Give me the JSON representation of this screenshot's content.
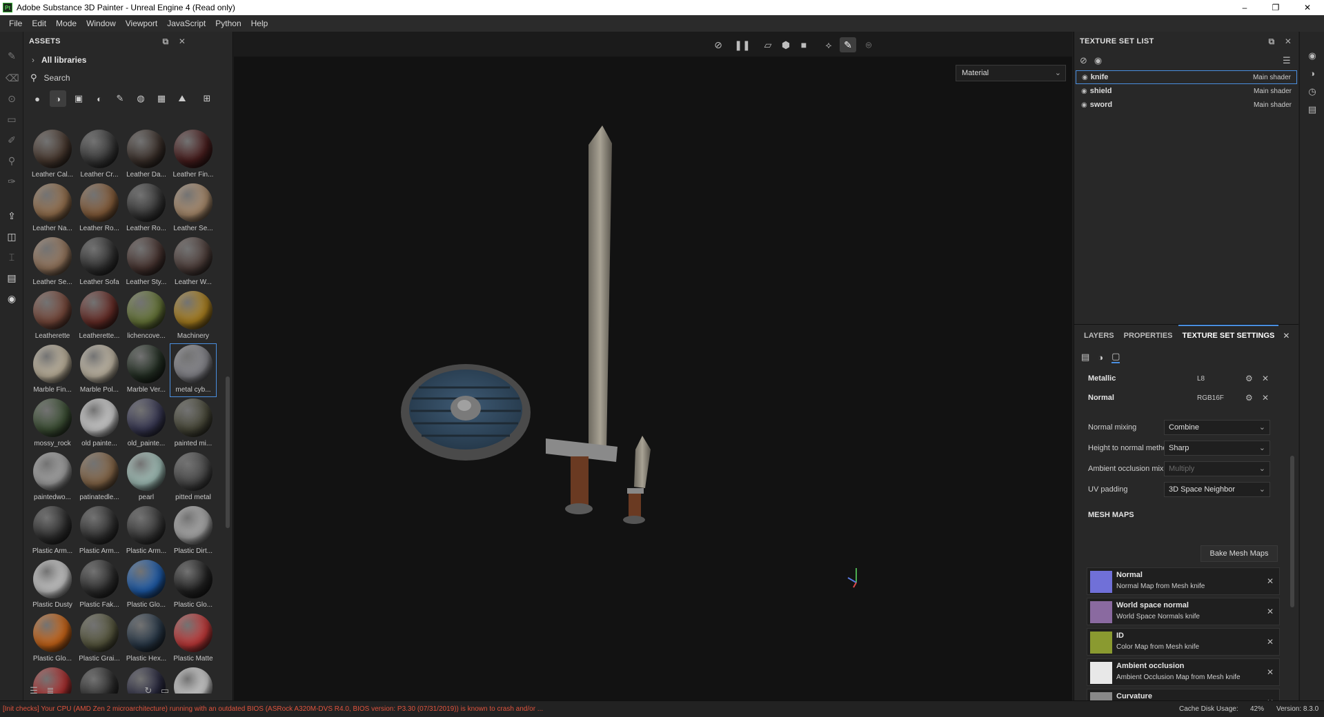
{
  "window": {
    "title": "Adobe Substance 3D Painter - Unreal Engine 4 (Read only)",
    "app_icon": "Pt",
    "controls": [
      "–",
      "❐",
      "✕"
    ]
  },
  "menu": [
    "File",
    "Edit",
    "Mode",
    "Window",
    "Viewport",
    "JavaScript",
    "Python",
    "Help"
  ],
  "assets": {
    "title": "ASSETS",
    "libraries_label": "All libraries",
    "search_label": "Search",
    "materials": [
      {
        "name": "Leather Cal...",
        "color": "#4a3a30"
      },
      {
        "name": "Leather Cr...",
        "color": "#3a3a3a"
      },
      {
        "name": "Leather Da...",
        "color": "#3d322c"
      },
      {
        "name": "Leather Fin...",
        "color": "#4a1e1e"
      },
      {
        "name": "Leather Na...",
        "color": "#9a7450"
      },
      {
        "name": "Leather Ro...",
        "color": "#8a603c"
      },
      {
        "name": "Leather Ro...",
        "color": "#383838"
      },
      {
        "name": "Leather Se...",
        "color": "#b09070"
      },
      {
        "name": "Leather Se...",
        "color": "#9a7a60"
      },
      {
        "name": "Leather Sofa",
        "color": "#333333"
      },
      {
        "name": "Leather Sty...",
        "color": "#4a3632"
      },
      {
        "name": "Leather W...",
        "color": "#50403c"
      },
      {
        "name": "Leatherette",
        "color": "#7a4a3c"
      },
      {
        "name": "Leatherette...",
        "color": "#6a2e28"
      },
      {
        "name": "lichencove...",
        "color": "#6a7a3a"
      },
      {
        "name": "Machinery",
        "color": "#b08420"
      },
      {
        "name": "Marble Fin...",
        "color": "#c8bca4"
      },
      {
        "name": "Marble Pol...",
        "color": "#cac0ac"
      },
      {
        "name": "Marble Ver...",
        "color": "#243024"
      },
      {
        "name": "metal cyb...",
        "color": "#8a8a90"
      },
      {
        "name": "mossy_rock",
        "color": "#3e5236"
      },
      {
        "name": "old painte...",
        "color": "#d8d8d8"
      },
      {
        "name": "old_painte...",
        "color": "#3a3a56"
      },
      {
        "name": "painted mi...",
        "color": "#4a4a3a"
      },
      {
        "name": "paintedwo...",
        "color": "#a8a8a8"
      },
      {
        "name": "patinatedle...",
        "color": "#8a6a4a"
      },
      {
        "name": "pearl",
        "color": "#a8c8c0"
      },
      {
        "name": "pitted metal",
        "color": "#4a4a4a"
      },
      {
        "name": "Plastic Arm...",
        "color": "#303030"
      },
      {
        "name": "Plastic Arm...",
        "color": "#333333"
      },
      {
        "name": "Plastic Arm...",
        "color": "#3a3a3a"
      },
      {
        "name": "Plastic Dirt...",
        "color": "#b0b0b0"
      },
      {
        "name": "Plastic Dusty",
        "color": "#d0d0d0"
      },
      {
        "name": "Plastic Fak...",
        "color": "#2e2e2e"
      },
      {
        "name": "Plastic Glo...",
        "color": "#1f5fb0"
      },
      {
        "name": "Plastic Glo...",
        "color": "#222222"
      },
      {
        "name": "Plastic Glo...",
        "color": "#d06818"
      },
      {
        "name": "Plastic Grai...",
        "color": "#5a5a40"
      },
      {
        "name": "Plastic Hex...",
        "color": "#2a3a4a"
      },
      {
        "name": "Plastic Matte",
        "color": "#c83a3a"
      },
      {
        "name": "",
        "color": "#b03030"
      },
      {
        "name": "",
        "color": "#2e2e2e"
      },
      {
        "name": "",
        "color": "#2a2a40"
      },
      {
        "name": "",
        "color": "#d8d8d8"
      }
    ]
  },
  "viewport": {
    "mode_select": "Material"
  },
  "texture_set_list": {
    "title": "TEXTURE SET LIST",
    "items": [
      {
        "name": "knife",
        "shader": "Main shader"
      },
      {
        "name": "shield",
        "shader": "Main shader"
      },
      {
        "name": "sword",
        "shader": "Main shader"
      }
    ]
  },
  "settings": {
    "tabs": [
      "LAYERS",
      "PROPERTIES",
      "TEXTURE SET SETTINGS"
    ],
    "channels": [
      {
        "name": "Metallic",
        "format": "L8"
      },
      {
        "name": "Normal",
        "format": "RGB16F"
      }
    ],
    "normal_mixing_label": "Normal mixing",
    "normal_mixing_value": "Combine",
    "height_method_label": "Height to normal method",
    "height_method_value": "Sharp",
    "ao_mixing_label": "Ambient occlusion mixing",
    "ao_mixing_value": "Multiply",
    "uv_padding_label": "UV padding",
    "uv_padding_value": "3D Space Neighbor",
    "mesh_maps_title": "MESH MAPS",
    "bake_button": "Bake Mesh Maps",
    "mesh_maps": [
      {
        "name": "Normal",
        "desc": "Normal Map from Mesh knife",
        "color": "#7070d8"
      },
      {
        "name": "World space normal",
        "desc": "World Space Normals knife",
        "color": "#8a6aa0"
      },
      {
        "name": "ID",
        "desc": "Color Map from Mesh knife",
        "color": "#8a9a30"
      },
      {
        "name": "Ambient occlusion",
        "desc": "Ambient Occlusion Map from Mesh knife",
        "color": "#e8e8e8"
      },
      {
        "name": "Curvature",
        "desc": "",
        "color": "#888888"
      }
    ]
  },
  "status": {
    "warning": "[Init checks] Your CPU (AMD Zen 2 microarchitecture) running with an outdated BIOS (ASRock A320M-DVS R4.0, BIOS version: P3.30 (07/31/2019)) is known to crash and/or ...",
    "cache_label": "Cache Disk Usage:",
    "cache_value": "42%",
    "version": "Version: 8.3.0"
  }
}
